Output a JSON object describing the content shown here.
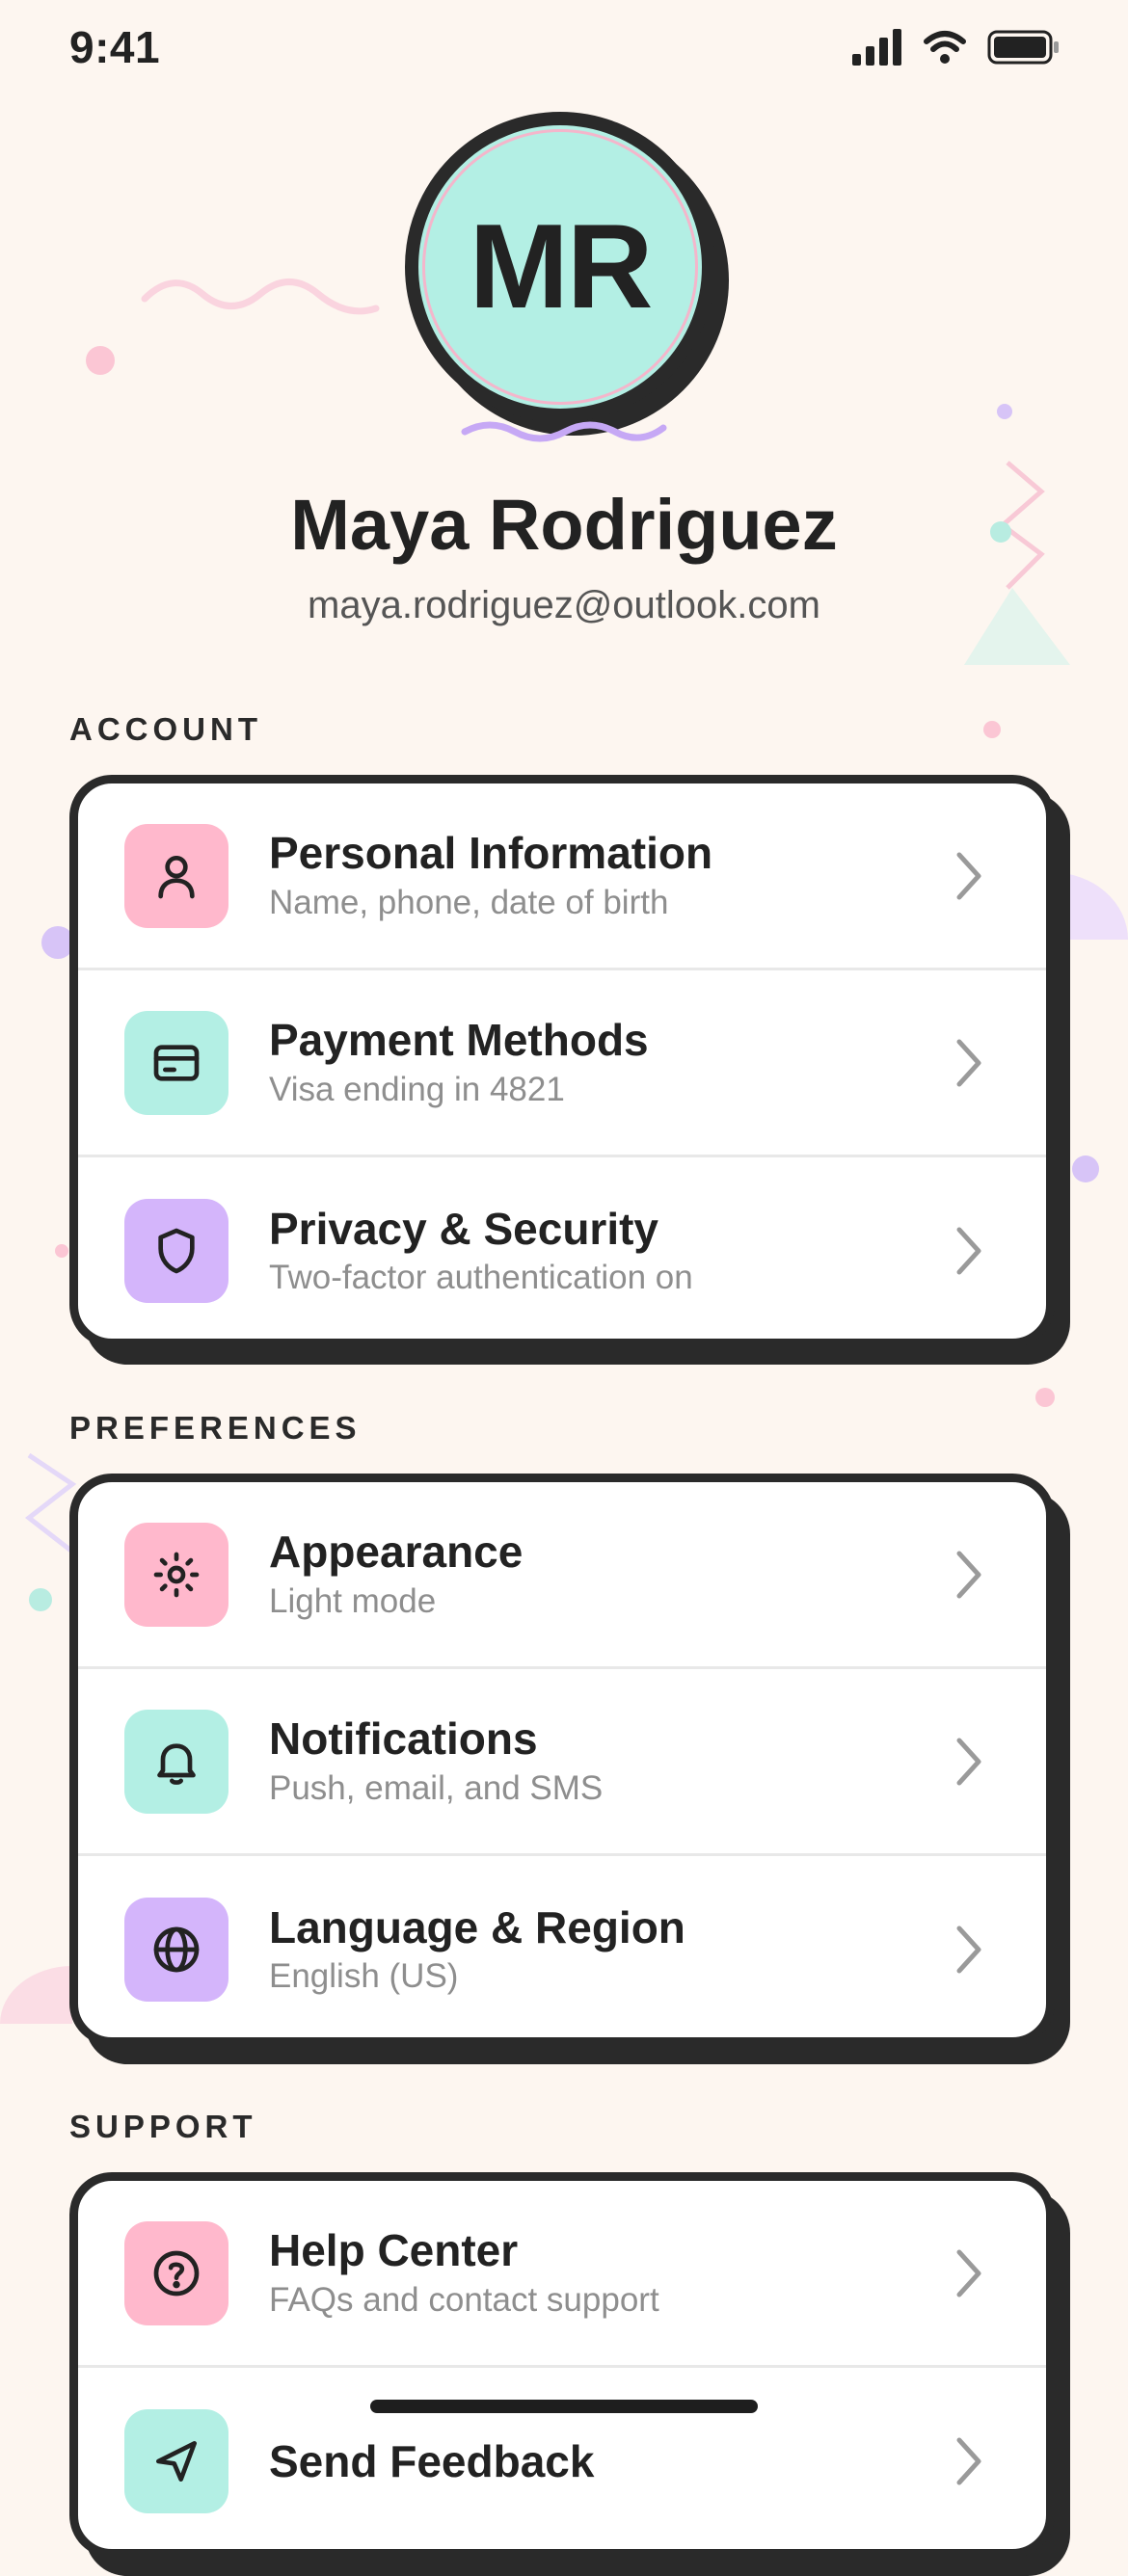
{
  "status_bar": {
    "time": "9:41"
  },
  "profile": {
    "initials": "MR",
    "name": "Maya Rodriguez",
    "email": "maya.rodriguez@outlook.com"
  },
  "colors": {
    "background": "#FDF6F0",
    "ink": "#2A2A2A",
    "pink": "#FFB8CC",
    "mint": "#B3EFE4",
    "lavender": "#D4B5FB",
    "subtext": "#8E8E8E"
  },
  "sections": [
    {
      "title": "ACCOUNT",
      "items": [
        {
          "title": "Personal Information",
          "subtitle": "Name, phone, date of birth",
          "icon": "person-icon",
          "color": "#FFB8CC"
        },
        {
          "title": "Payment Methods",
          "subtitle": "Visa ending in 4821",
          "icon": "credit-card-icon",
          "color": "#B3EFE4"
        },
        {
          "title": "Privacy & Security",
          "subtitle": "Two-factor authentication on",
          "icon": "shield-icon",
          "color": "#D4B5FB"
        }
      ]
    },
    {
      "title": "PREFERENCES",
      "items": [
        {
          "title": "Appearance",
          "subtitle": "Light mode",
          "icon": "sun-icon",
          "color": "#FFB8CC"
        },
        {
          "title": "Notifications",
          "subtitle": "Push, email, and SMS",
          "icon": "bell-icon",
          "color": "#B3EFE4"
        },
        {
          "title": "Language & Region",
          "subtitle": "English (US)",
          "icon": "globe-icon",
          "color": "#D4B5FB"
        }
      ]
    },
    {
      "title": "SUPPORT",
      "items": [
        {
          "title": "Help Center",
          "subtitle": "FAQs and contact support",
          "icon": "help-circle-icon",
          "color": "#FFB8CC"
        },
        {
          "title": "Send Feedback",
          "subtitle": "",
          "icon": "send-icon",
          "color": "#B3EFE4"
        }
      ]
    }
  ]
}
